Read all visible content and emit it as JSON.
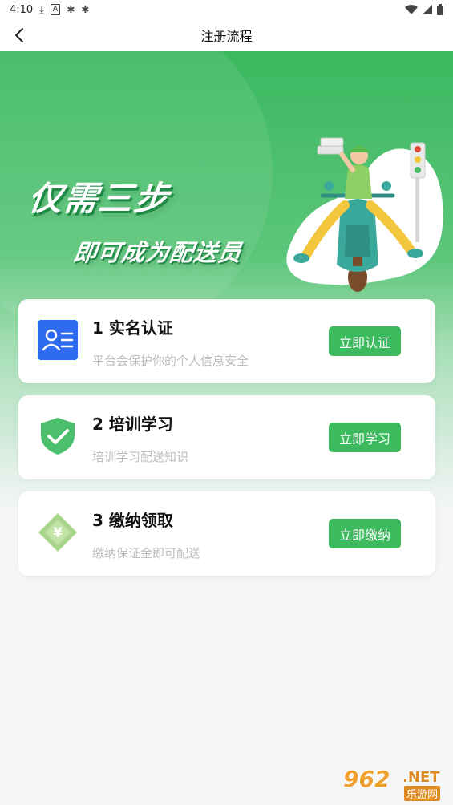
{
  "status_bar": {
    "time": "4:10",
    "icons_left": [
      "download-icon",
      "a-icon",
      "bug-icon",
      "bug-icon"
    ],
    "icons_right": [
      "wifi-icon",
      "signal-icon",
      "battery-icon"
    ]
  },
  "nav": {
    "title": "注册流程",
    "back_icon": "chevron-left-icon"
  },
  "hero": {
    "slogan_line1": "仅需三步",
    "slogan_line2": "即可成为配送员",
    "illustration": "delivery-rider-on-scooter-illustration"
  },
  "steps": [
    {
      "title": "1 实名认证",
      "subtitle": "平台会保护你的个人信息安全",
      "button": "立即认证",
      "icon": "id-card-icon"
    },
    {
      "title": "2 培训学习",
      "subtitle": "培训学习配送知识",
      "button": "立即学习",
      "icon": "shield-check-icon"
    },
    {
      "title": "3 缴纳领取",
      "subtitle": "缴纳保证金即可配送",
      "button": "立即缴纳",
      "icon": "yuan-diamond-icon"
    }
  ],
  "watermark": {
    "number": "962",
    "domain": ".NET",
    "name": "乐游网"
  },
  "colors": {
    "accent": "#3dba5e",
    "hero_top": "#3bb860",
    "background": "#f4f5f7",
    "id_card_blue": "#2f6bf0"
  }
}
